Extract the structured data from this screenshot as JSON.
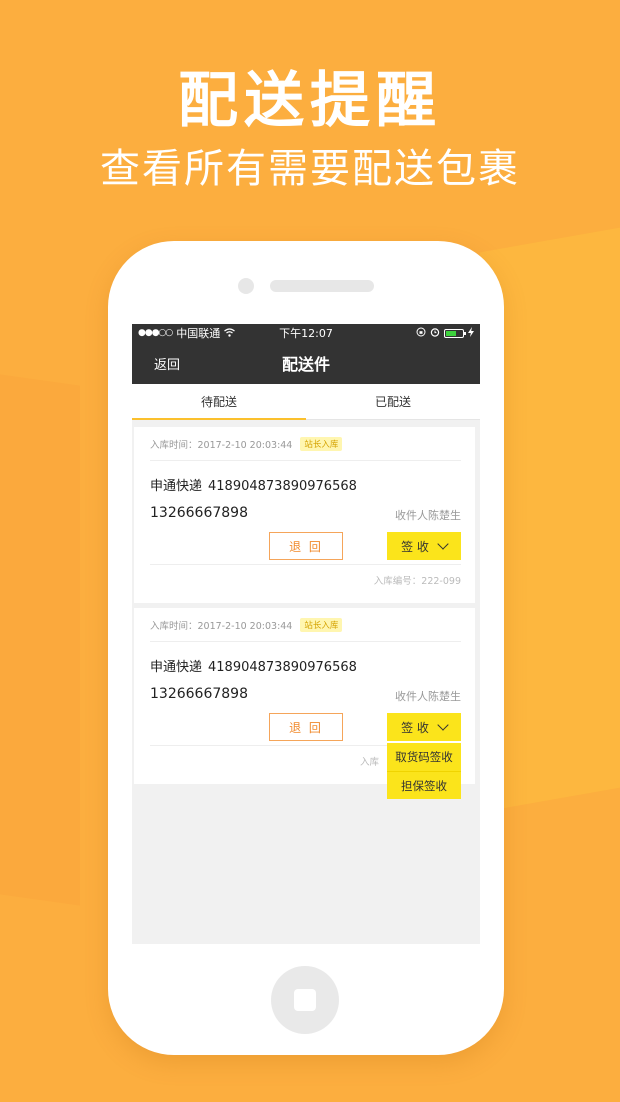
{
  "banner": {
    "title": "配送提醒",
    "subtitle": "查看所有需要配送包裹"
  },
  "statusbar": {
    "signal": "●●●○○",
    "carrier": "中国联通",
    "time": "下午12:07",
    "battery_level": 0.6
  },
  "navbar": {
    "back_label": "返回",
    "title": "配送件"
  },
  "tabs": [
    {
      "label": "待配送",
      "active": true
    },
    {
      "label": "已配送",
      "active": false
    }
  ],
  "cards": [
    {
      "storage_time": "入库时间：2017-2-10 20:03:44",
      "tag": "站长入库",
      "courier": "申通快递",
      "tracking_no": "418904873890976568",
      "phone": "13266667898",
      "receiver": "收件人陈楚生",
      "return_label": "退 回",
      "sign_label": "签 收",
      "storage_no": "入库编号：222-099"
    },
    {
      "storage_time": "入库时间：2017-2-10 20:03:44",
      "tag": "站长入库",
      "courier": "申通快递",
      "tracking_no": "418904873890976568",
      "phone": "13266667898",
      "receiver": "收件人陈楚生",
      "return_label": "退 回",
      "sign_label": "签 收",
      "storage_no": "入库",
      "dropdown": [
        "取货码签收",
        "担保签收"
      ]
    }
  ],
  "colors": {
    "background": "#fcae3f",
    "dark_bar": "#333333",
    "accent_yellow": "#fbe41b",
    "return_orange": "#f08a2c"
  }
}
